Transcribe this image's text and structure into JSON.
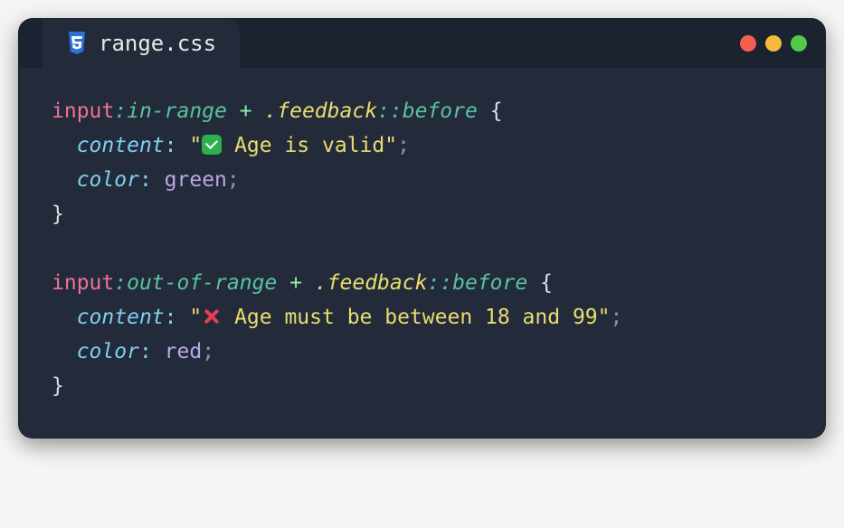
{
  "tab": {
    "filename": "range.css"
  },
  "code": {
    "rule1": {
      "selector_tag": "input",
      "selector_pseudo": ":in-range",
      "combinator": " + ",
      "selector_class": ".feedback",
      "selector_pseudoel": "::before",
      "prop1": "content",
      "val1_prefix": "\"",
      "val1_text": " Age is valid\"",
      "prop2": "color",
      "val2": "green"
    },
    "rule2": {
      "selector_tag": "input",
      "selector_pseudo": ":out-of-range",
      "combinator": " + ",
      "selector_class": ".feedback",
      "selector_pseudoel": "::before",
      "prop1": "content",
      "val1_prefix": "\"",
      "val1_text": " Age must be between 18 and 99\"",
      "prop2": "color",
      "val2": "red"
    }
  }
}
